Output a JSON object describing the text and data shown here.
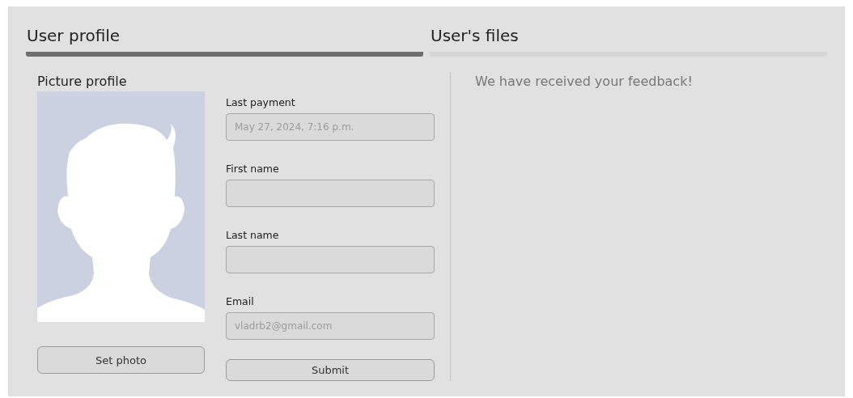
{
  "tabs": [
    {
      "label": "User profile",
      "selected": true
    },
    {
      "label": "User's files",
      "selected": false
    }
  ],
  "picture_section": {
    "title": "Picture profile",
    "button": "Set photo"
  },
  "form": {
    "fields": [
      {
        "label": "Last payment",
        "placeholder": "May 27, 2024, 7:16 p.m."
      },
      {
        "label": "First name"
      },
      {
        "label": "Last name"
      },
      {
        "label": "Email",
        "placeholder": "vladrb2@gmail.com"
      }
    ],
    "button": "Submit"
  },
  "message": "We have received your feedback!"
}
